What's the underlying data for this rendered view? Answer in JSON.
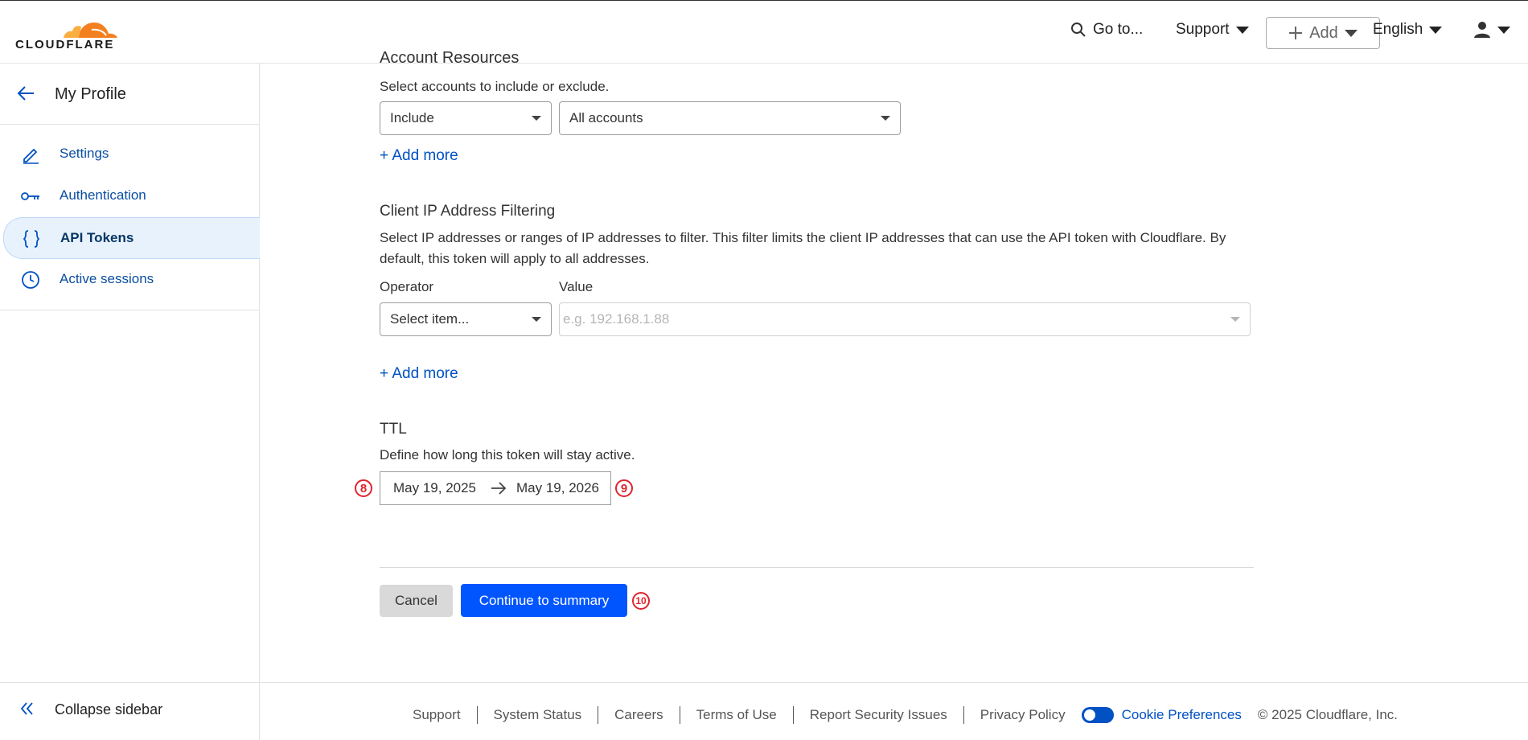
{
  "header": {
    "brand": "CLOUDFLARE",
    "goto_label": "Go to...",
    "support_label": "Support",
    "add_label": "Add",
    "language_label": "English"
  },
  "sidebar": {
    "title": "My Profile",
    "items": [
      {
        "label": "Settings",
        "icon": "pencil-icon"
      },
      {
        "label": "Authentication",
        "icon": "key-icon"
      },
      {
        "label": "API Tokens",
        "icon": "braces-icon",
        "active": true
      },
      {
        "label": "Active sessions",
        "icon": "clock-icon"
      }
    ],
    "collapse_label": "Collapse sidebar"
  },
  "account_resources": {
    "title": "Account Resources",
    "description": "Select accounts to include or exclude.",
    "include_select": "Include",
    "accounts_select": "All accounts",
    "add_more": "+ Add more"
  },
  "ip_filtering": {
    "title": "Client IP Address Filtering",
    "description_line1": "Select IP addresses or ranges of IP addresses to filter. This filter limits the client IP addresses that can use the API token with Cloudflare. By",
    "description_line2": "default, this token will apply to all addresses.",
    "operator_label": "Operator",
    "operator_select": "Select item...",
    "value_label": "Value",
    "value_placeholder": "e.g. 192.168.1.88",
    "add_more": "+ Add more"
  },
  "ttl": {
    "title": "TTL",
    "description": "Define how long this token will stay active.",
    "start_date": "May 19, 2025",
    "end_date": "May 19, 2026"
  },
  "annotations": {
    "badge_8": "8",
    "badge_9": "9",
    "badge_10": "10"
  },
  "actions": {
    "cancel_label": "Cancel",
    "continue_label": "Continue to summary"
  },
  "footer": {
    "links": [
      "Support",
      "System Status",
      "Careers",
      "Terms of Use",
      "Report Security Issues",
      "Privacy Policy"
    ],
    "cookie_label": "Cookie Preferences",
    "copyright": "© 2025 Cloudflare, Inc."
  },
  "colors": {
    "accent": "#0051c3",
    "primary_button": "#0055ff",
    "brand_orange": "#f38020",
    "badge_red": "#e0242f"
  }
}
